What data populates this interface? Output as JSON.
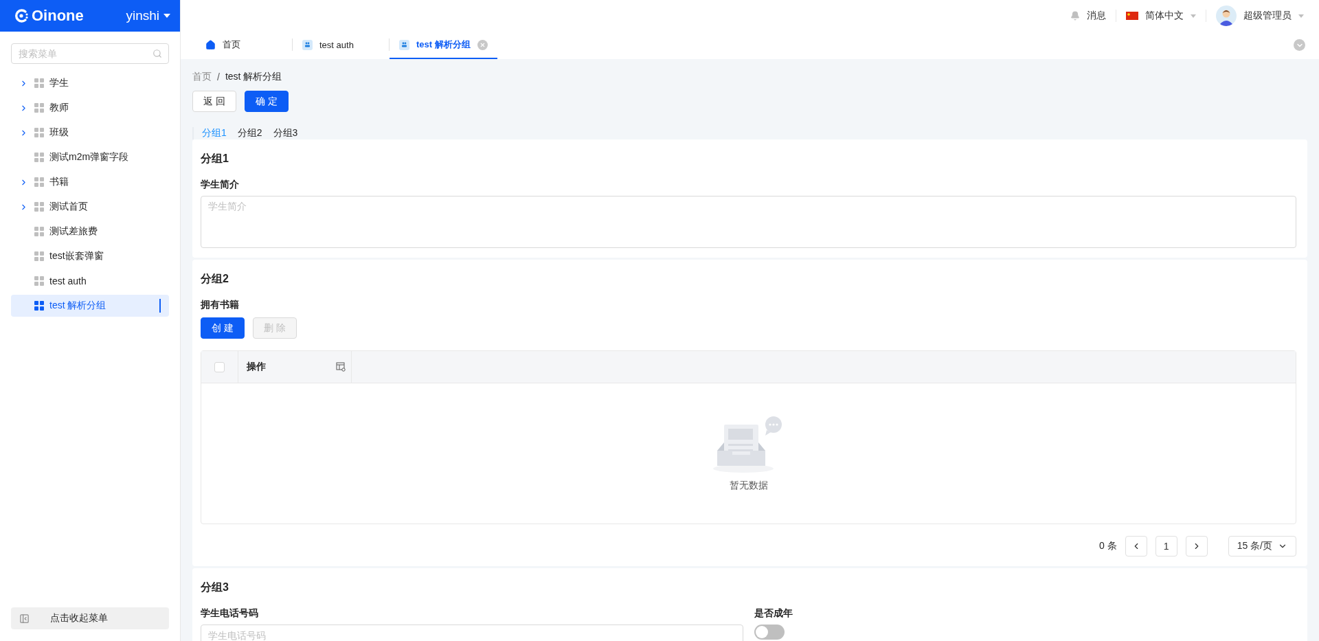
{
  "sidebar": {
    "brand": "Oinone",
    "workspace": "yinshi",
    "search": {
      "placeholder": "搜索菜单"
    },
    "items": [
      {
        "label": "学生",
        "expandable": true,
        "selected": false
      },
      {
        "label": "教师",
        "expandable": true,
        "selected": false
      },
      {
        "label": "班级",
        "expandable": true,
        "selected": false
      },
      {
        "label": "测试m2m弹窗字段",
        "expandable": false,
        "selected": false
      },
      {
        "label": "书籍",
        "expandable": true,
        "selected": false
      },
      {
        "label": "测试首页",
        "expandable": true,
        "selected": false
      },
      {
        "label": "测试差旅费",
        "expandable": false,
        "selected": false
      },
      {
        "label": "test嵌套弹窗",
        "expandable": false,
        "selected": false
      },
      {
        "label": "test auth",
        "expandable": false,
        "selected": false
      },
      {
        "label": "test 解析分组",
        "expandable": false,
        "selected": true
      }
    ],
    "collapse_button": "点击收起菜单"
  },
  "header": {
    "notifications": "消息",
    "language": "简体中文",
    "user": "超级管理员"
  },
  "tabs": [
    {
      "label": "首页",
      "kind": "home",
      "selected": false,
      "closable": false
    },
    {
      "label": "test auth",
      "kind": "page",
      "selected": false,
      "closable": false
    },
    {
      "label": "test 解析分组",
      "kind": "page",
      "selected": true,
      "closable": true
    }
  ],
  "breadcrumb": [
    "首页",
    "test 解析分组"
  ],
  "breadcrumb_separator": "/",
  "actions": [
    {
      "label": "返 回",
      "kind": "default"
    },
    {
      "label": "确 定",
      "kind": "primary"
    }
  ],
  "group_tabs": [
    {
      "label": "分组1",
      "selected": true
    },
    {
      "label": "分组2",
      "selected": false
    },
    {
      "label": "分组3",
      "selected": false
    }
  ],
  "groups": [
    {
      "title": "分组1",
      "fields": [
        {
          "kind": "textarea",
          "label": "学生简介",
          "placeholder": "学生简介"
        }
      ]
    },
    {
      "title": "分组2",
      "fields": [
        {
          "kind": "table",
          "label": "拥有书籍",
          "buttons": [
            {
              "label": "创 建",
              "disabled": false
            },
            {
              "label": "删 除",
              "disabled": true
            }
          ],
          "columns": [
            {
              "label": "操作"
            }
          ],
          "select_all_checked": false,
          "empty_text": "暂无数据",
          "pagination": {
            "total": "0 条",
            "page": "1",
            "page_size": "15 条/页"
          }
        }
      ]
    },
    {
      "title": "分组3",
      "fields": [
        {
          "kind": "input",
          "label": "学生电话号码",
          "placeholder": "学生电话号码"
        },
        {
          "kind": "switch",
          "label": "是否成年",
          "on": false
        }
      ]
    }
  ]
}
